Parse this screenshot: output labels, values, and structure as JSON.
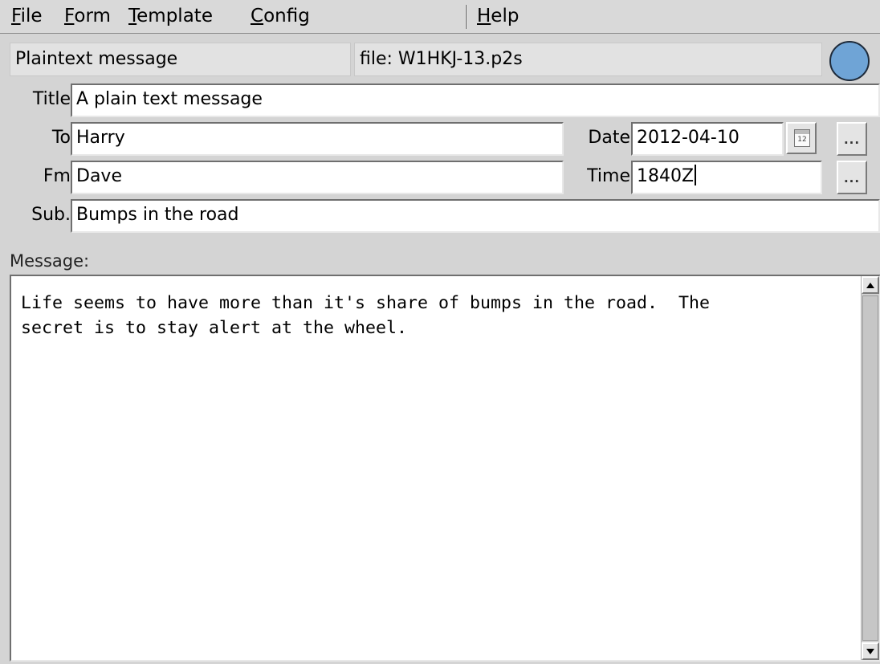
{
  "menu": {
    "items": [
      {
        "label": "File",
        "key": "F",
        "rest": "ile"
      },
      {
        "label": "Form",
        "key": "F",
        "rest": "orm"
      },
      {
        "label": "Template",
        "key": "T",
        "rest": "emplate"
      },
      {
        "label": "Config",
        "key": "C",
        "rest": "onfig"
      },
      {
        "label": "Help",
        "key": "H",
        "rest": "elp"
      }
    ]
  },
  "header": {
    "form_type": "Plaintext message",
    "file_label": "file: W1HKJ-13.p2s",
    "status_color": "#6fa4d6"
  },
  "form": {
    "title_label": "Title",
    "title_value": "A plain text message",
    "to_label": "To",
    "to_value": "Harry",
    "fm_label": "Fm",
    "fm_value": "Dave",
    "date_label": "Date",
    "date_value": "2012-04-10",
    "time_label": "Time",
    "time_value": "1840Z",
    "sub_label": "Sub.",
    "sub_value": "Bumps in the road",
    "calendar_icon_text": "12",
    "dots_label": "..."
  },
  "message": {
    "label": "Message:",
    "text": "Life seems to have more than it's share of bumps in the road.  The\nsecret is to stay alert at the wheel."
  }
}
